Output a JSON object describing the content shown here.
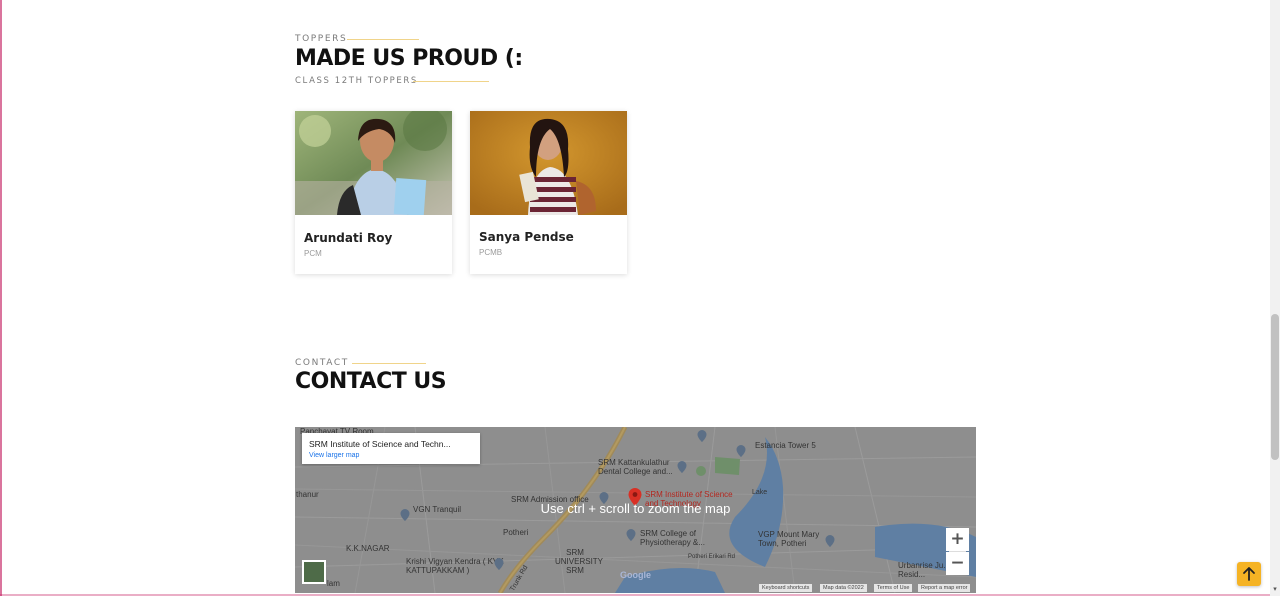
{
  "toppers": {
    "eyebrow": "TOPPERS",
    "title": "MADE US PROUD (:",
    "subtitle": "CLASS 12TH TOPPERS",
    "cards": [
      {
        "name": "Arundati Roy",
        "stream": "PCM"
      },
      {
        "name": "Sanya Pendse",
        "stream": "PCMB"
      }
    ]
  },
  "contact": {
    "eyebrow": "CONTACT",
    "title": "CONTACT US"
  },
  "map": {
    "info_title": "SRM Institute of Science and Techn...",
    "info_link": "View larger map",
    "overlay": "Use ctrl + scroll to zoom the map",
    "zoom_in": "+",
    "zoom_out": "−",
    "labels": {
      "panchayat": "Panchayat TV Room",
      "estancia": "Estancia Tower 5",
      "srm_dental": "SRM Kattankulathur Dental College and...",
      "thanur": "thanur",
      "srm_admission": "SRM Admission office",
      "srm_institute": "SRM Institute of Science and Technology",
      "vgn": "VGN Tranquil",
      "vgp": "VGP Mount Mary Town, Potheri",
      "kk_nagar": "K.K.NAGAR",
      "potheri": "Potheri",
      "srm_university": "SRM UNIVERSITY SRM",
      "srm_physio": "SRM College of Physiotherapy &...",
      "krishi": "Krishi Vigyan Kendra ( KVK KATTUPAKKAM )",
      "urbanrise": "Urbanrise Ju... Resid...",
      "potheri_road": "Potheri Erikari Rd",
      "lake": "Lake",
      "lam": "lam",
      "trunk": "Trunk Rd"
    },
    "google": "Google",
    "attribution": {
      "keyboard": "Keyboard shortcuts",
      "mapdata": "Map data ©2022",
      "terms": "Terms of Use",
      "report": "Report a map error"
    }
  },
  "colors": {
    "accent": "#f5b324",
    "eyebrow_line": "#f0d48a",
    "pin": "#d93025"
  },
  "icons": {
    "scroll_top": "arrow-up-icon",
    "map_pin": "map-pin-icon"
  }
}
